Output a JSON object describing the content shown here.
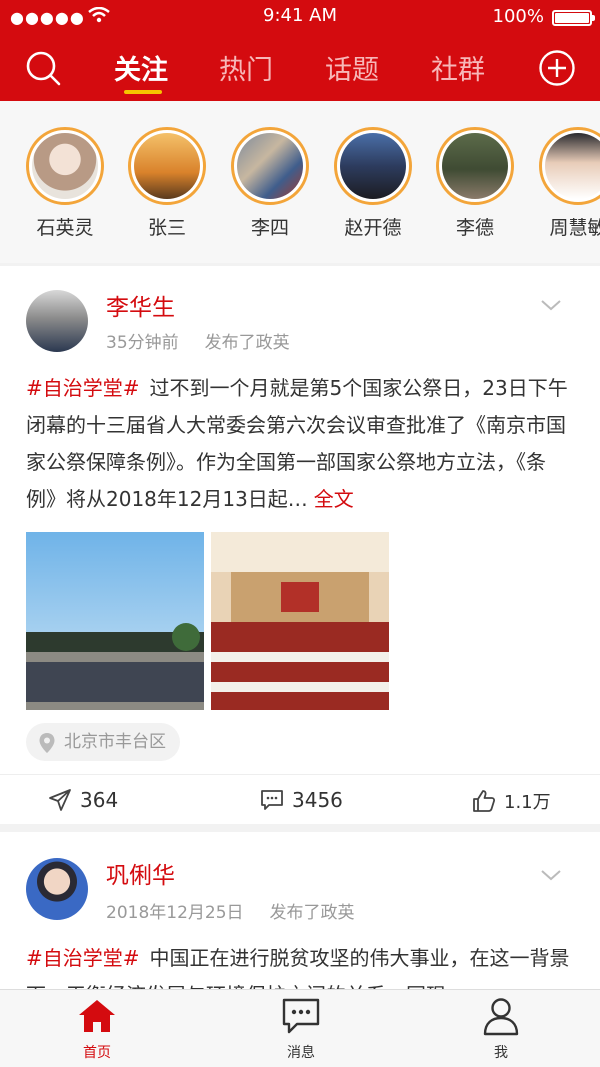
{
  "status_bar": {
    "signal": "●●●●●",
    "time": "9:41 AM",
    "battery": "100%"
  },
  "top_nav": {
    "tabs": [
      {
        "label": "关注",
        "active": true
      },
      {
        "label": "热门",
        "active": false
      },
      {
        "label": "话题",
        "active": false
      },
      {
        "label": "社群",
        "active": false
      }
    ],
    "search_icon": "search-icon",
    "add_icon": "plus-circle-icon"
  },
  "stories": [
    {
      "name": "石英灵"
    },
    {
      "name": "张三"
    },
    {
      "name": "李四"
    },
    {
      "name": "赵开德"
    },
    {
      "name": "李德"
    },
    {
      "name": "周慧敏"
    }
  ],
  "posts": [
    {
      "author": "李华生",
      "time": "35分钟前",
      "action": "发布了政英",
      "hashtag": "#自治学堂#",
      "text": "过不到一个月就是第5个国家公祭日，23日下午闭幕的十三届省人大常委会第六次会议审查批准了《南京市国家公祭保障条例》。作为全国第一部国家公祭地方立法，《条例》将从2018年12月13日起…",
      "more": "全文",
      "location": "北京市丰台区",
      "shares": "364",
      "comments": "3456",
      "likes": "1.1万"
    },
    {
      "author": "巩俐华",
      "time": "2018年12月25日",
      "action": "发布了政英",
      "hashtag": "#自治学堂#",
      "text": "中国正在进行脱贫攻坚的伟大事业，在这一背景下，平衡经济发展与环境保护之间的关系，同现"
    }
  ],
  "tab_bar": [
    {
      "label": "首页",
      "icon": "home-icon",
      "active": true
    },
    {
      "label": "消息",
      "icon": "chat-icon",
      "active": false
    },
    {
      "label": "我",
      "icon": "profile-icon",
      "active": false
    }
  ],
  "colors": {
    "brand": "#d40b0f",
    "story_ring": "#f3a53a",
    "tab_underline": "#f6c400"
  }
}
